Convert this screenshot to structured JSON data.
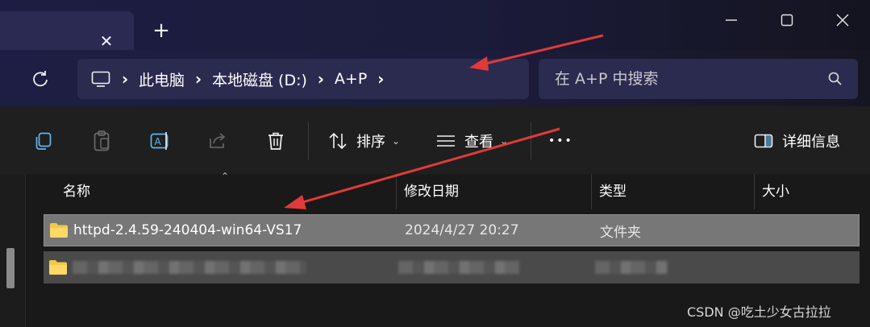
{
  "window": {
    "tab_close_glyph": "✕",
    "new_tab_glyph": "+"
  },
  "breadcrumb": {
    "items": [
      "此电脑",
      "本地磁盘 (D:)",
      "A+P"
    ]
  },
  "search": {
    "placeholder": "在 A+P 中搜索"
  },
  "toolbar": {
    "sort_label": "排序",
    "view_label": "查看",
    "more_glyph": "•••",
    "details_label": "详细信息"
  },
  "columns": [
    "名称",
    "修改日期",
    "类型",
    "大小"
  ],
  "files": [
    {
      "name": "httpd-2.4.59-240404-win64-VS17",
      "modified": "2024/4/27 20:27",
      "type": "文件夹",
      "size": ""
    }
  ],
  "watermark": "CSDN @吃土少女古拉拉",
  "colors": {
    "accent": "#2b2a4f",
    "selection": "#777777",
    "folder": "#f2c94c",
    "arrow": "#e03a3a"
  }
}
